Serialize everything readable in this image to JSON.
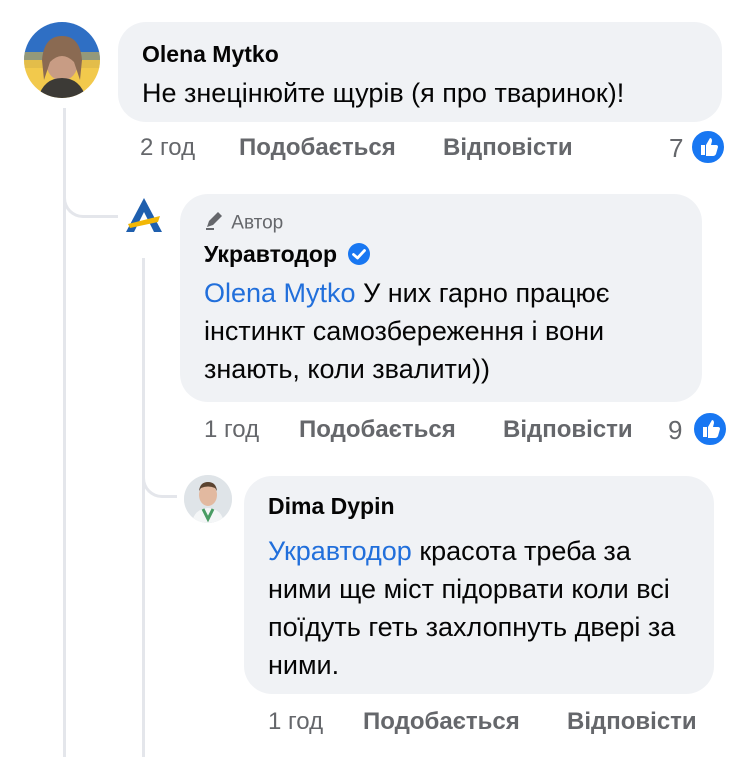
{
  "colors": {
    "accent": "#1877f2",
    "mention": "#216fdb",
    "bubble": "#f0f2f5",
    "meta": "#65676b"
  },
  "comments": [
    {
      "author": "Olena  Mytko",
      "text": "Не знецінюйте щурів (я про тваринок)!",
      "time": "2 год",
      "like_label": "Подобається",
      "reply_label": "Відповісти",
      "likes": "7"
    },
    {
      "badge": "Автор",
      "author": "Укравтодор",
      "mention": "Olena  Mytko",
      "text": "У них гарно працює інстинкт самозбереження і вони знають, коли звалити))",
      "time": "1 год",
      "like_label": "Подобається",
      "reply_label": "Відповісти",
      "likes": "9"
    },
    {
      "author": "Dima Dypin",
      "mention": "Укравтодор",
      "text": "красота треба за ними ще міст підорвати коли всі поїдуть геть захлопнуть двері за ними.",
      "time": "1 год",
      "like_label": "Подобається",
      "reply_label": "Відповісти"
    }
  ],
  "icons": [
    "verified-badge-icon",
    "author-pen-icon",
    "like-thumb-icon"
  ]
}
